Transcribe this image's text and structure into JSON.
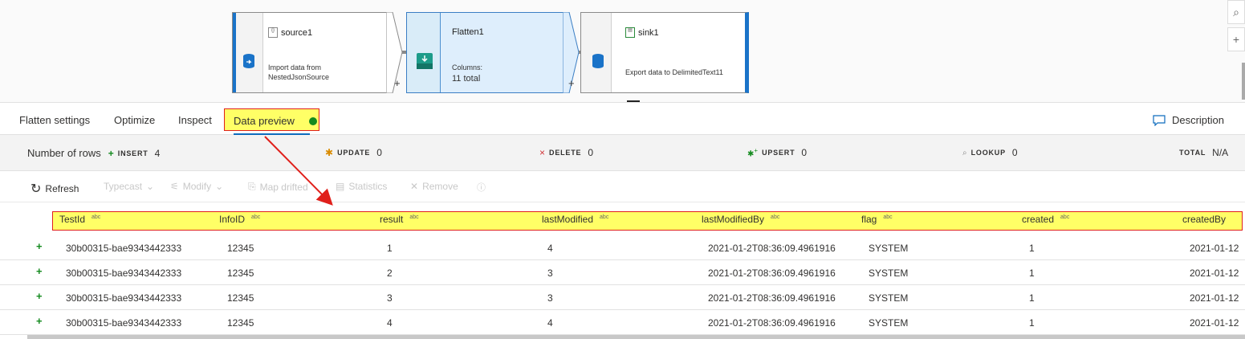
{
  "canvas": {
    "nodes": [
      {
        "id": "source",
        "title": "source1",
        "desc": "Import data from NestedJsonSource"
      },
      {
        "id": "flatten",
        "title": "Flatten1",
        "desc_label": "Columns:",
        "desc_value": "11 total"
      },
      {
        "id": "sink",
        "title": "sink1",
        "desc": "Export data to DelimitedText11"
      }
    ],
    "plus": "+"
  },
  "tabs": {
    "items": [
      "Flatten settings",
      "Optimize",
      "Inspect"
    ],
    "active": "Data preview",
    "description": "Description"
  },
  "stats": {
    "rows_label": "Number of rows",
    "insert_label": "INSERT",
    "insert_value": "4",
    "update_label": "UPDATE",
    "update_value": "0",
    "delete_label": "DELETE",
    "delete_value": "0",
    "upsert_label": "UPSERT",
    "upsert_value": "0",
    "lookup_label": "LOOKUP",
    "lookup_value": "0",
    "total_label": "TOTAL",
    "total_value": "N/A"
  },
  "toolbar": {
    "refresh": "Refresh",
    "typecast": "Typecast",
    "modify": "Modify",
    "map_drifted": "Map drifted",
    "statistics": "Statistics",
    "remove": "Remove"
  },
  "table": {
    "type_badge": "abc",
    "columns": [
      "TestId",
      "InfoID",
      "result",
      "lastModified",
      "lastModifiedBy",
      "flag",
      "created",
      "createdBy"
    ],
    "rows": [
      [
        "30b00315-bae9343442333",
        "12345",
        "1",
        "4",
        "2021-01-2T08:36:09.4961916",
        "SYSTEM",
        "1",
        "2021-01-12"
      ],
      [
        "30b00315-bae9343442333",
        "12345",
        "2",
        "3",
        "2021-01-2T08:36:09.4961916",
        "SYSTEM",
        "1",
        "2021-01-12"
      ],
      [
        "30b00315-bae9343442333",
        "12345",
        "3",
        "3",
        "2021-01-2T08:36:09.4961916",
        "SYSTEM",
        "1",
        "2021-01-12"
      ],
      [
        "30b00315-bae9343442333",
        "12345",
        "4",
        "4",
        "2021-01-2T08:36:09.4961916",
        "SYSTEM",
        "1",
        "2021-01-12"
      ]
    ]
  },
  "colors": {
    "accent": "#0f6cbd",
    "highlight": "#ffff66",
    "annotation": "#e0201b",
    "insert": "#138a1e"
  }
}
